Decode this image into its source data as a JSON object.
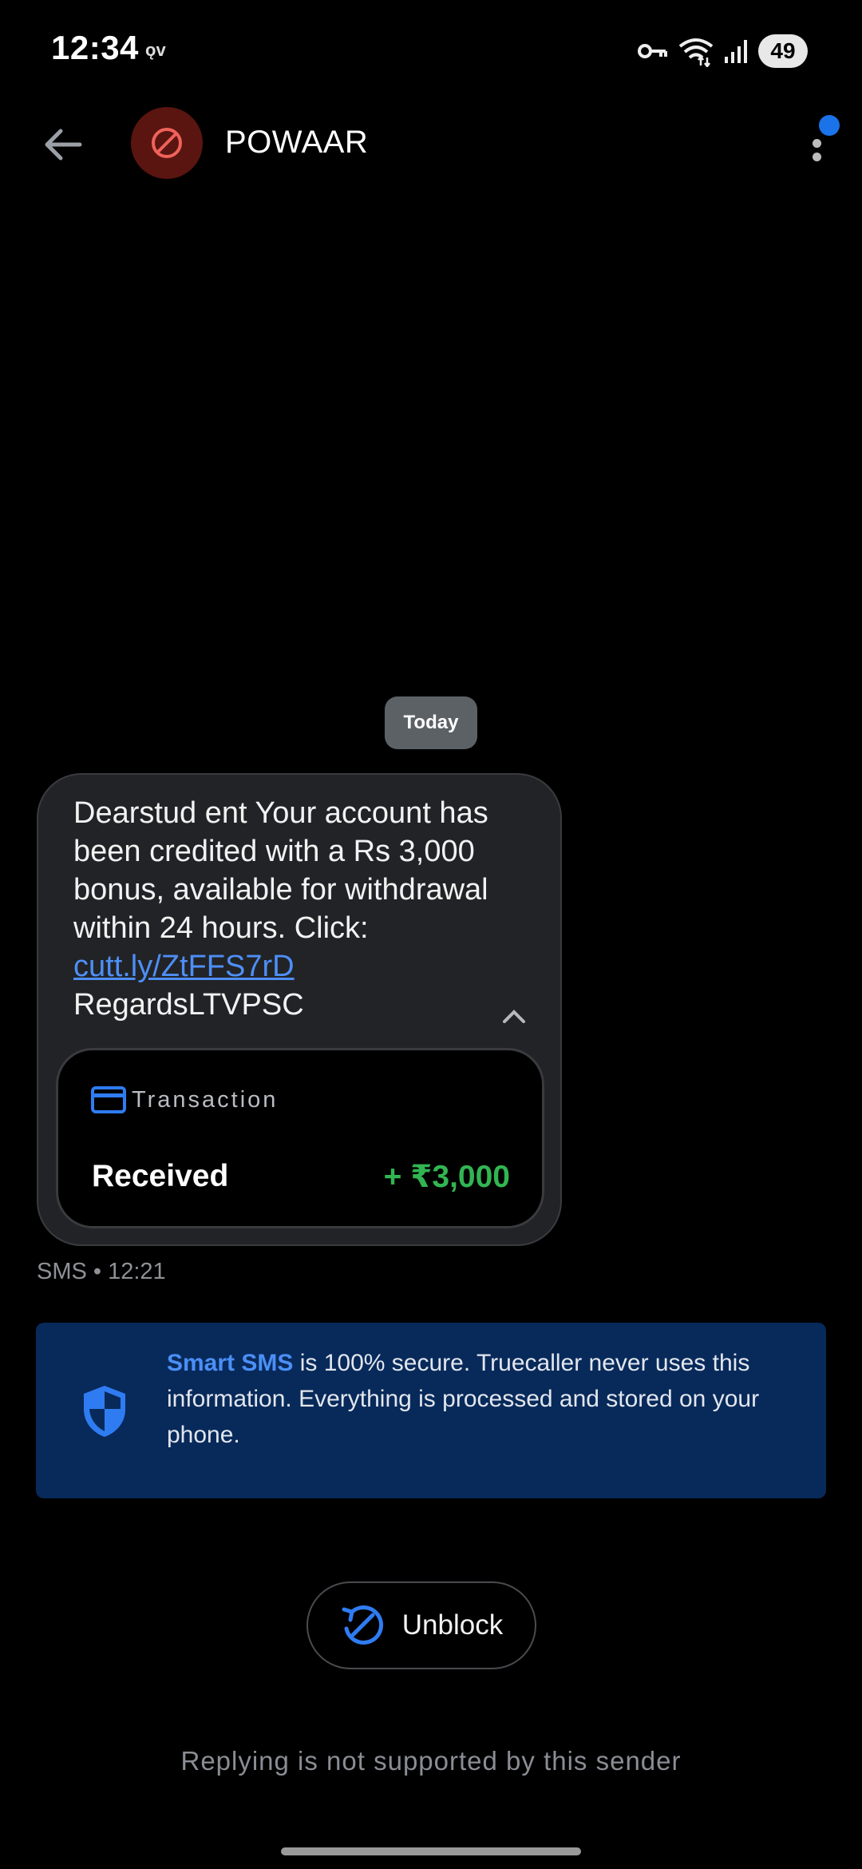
{
  "status_bar": {
    "time": "12:34",
    "carrier_tag": "ǫv",
    "battery": "49",
    "icons": [
      "vpn-key-icon",
      "wifi-icon",
      "signal-icon",
      "battery-icon"
    ]
  },
  "app_bar": {
    "sender_name": "POWAAR",
    "avatar_icon": "blocked-icon",
    "avatar_color": "#5a1511",
    "notification_color": "#1a73e8"
  },
  "conversation": {
    "date_chip": "Today",
    "message": {
      "text_before_link": "Dearstud ent Your account has been credited with a Rs 3,000 bonus, available for withdrawal within 24 hours. Click: ",
      "link": "cutt.ly/ZtFFS7rD",
      "text_after_link": "RegardsLTVPSC",
      "meta": "SMS • 12:21",
      "transaction_card": {
        "title": "Transaction",
        "status": "Received",
        "amount": "+ ₹3,000",
        "amount_color": "#32b552"
      }
    }
  },
  "info_banner": {
    "highlight": "Smart SMS",
    "text": " is 100% secure. Truecaller never uses this information. Everything is processed and stored on your phone.",
    "background": "#082a5a"
  },
  "unblock_button": {
    "label": "Unblock"
  },
  "reply_note": "Replying is not supported by this sender"
}
